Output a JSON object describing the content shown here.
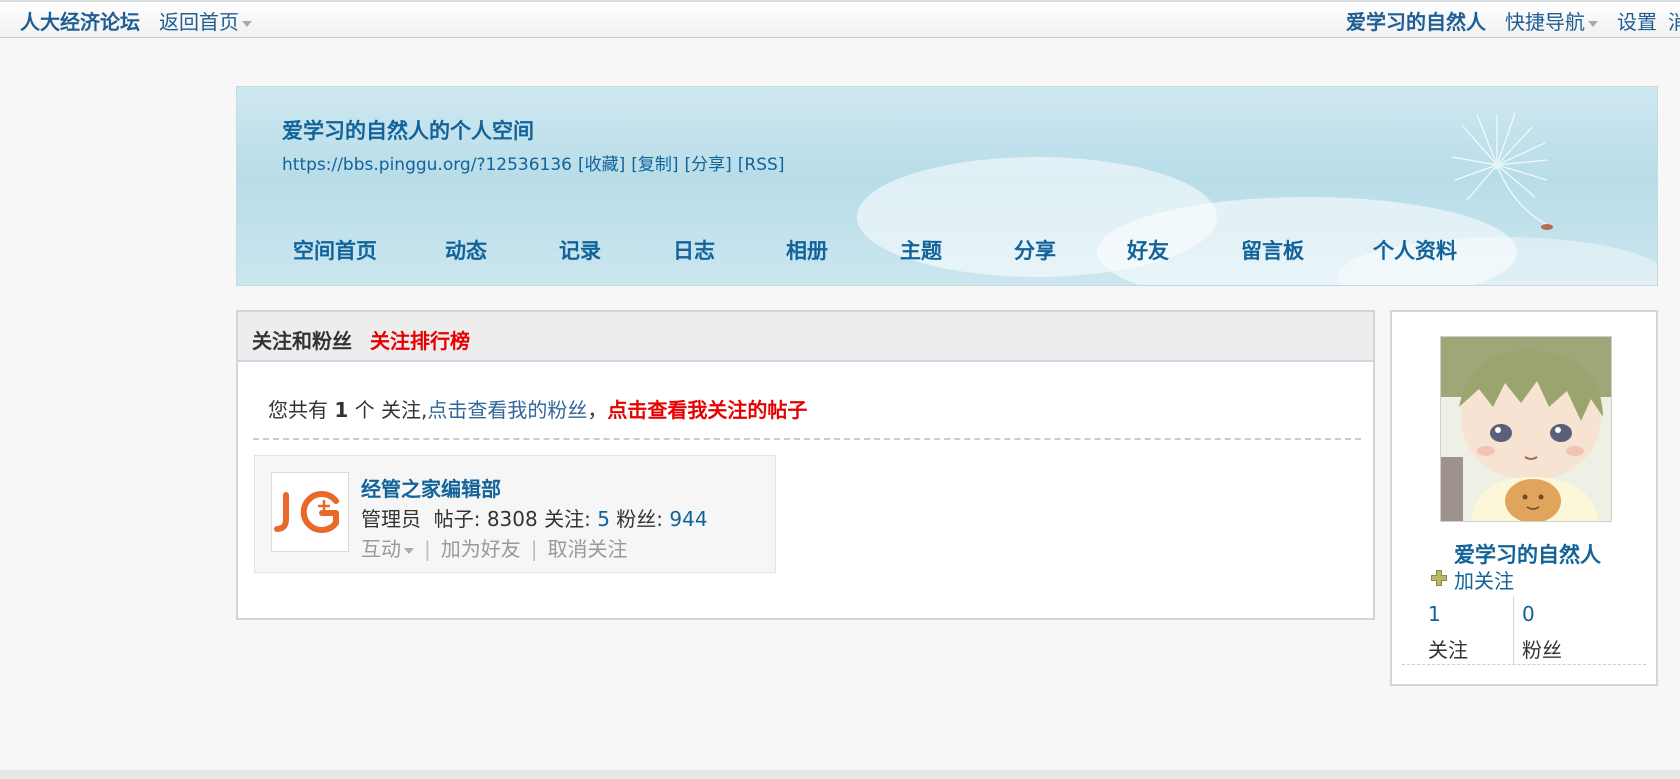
{
  "topbar": {
    "brand": "人大经济论坛",
    "home": "返回首页",
    "username": "爱学习的自然人",
    "quick_nav": "快捷导航",
    "settings": "设置",
    "cut_text": "消"
  },
  "header": {
    "space_title": "爱学习的自然人的个人空间",
    "url": "https://bbs.pinggu.org/?12536136",
    "url_actions": [
      "[收藏]",
      "[复制]",
      "[分享]",
      "[RSS]"
    ],
    "nav": [
      "空间首页",
      "动态",
      "记录",
      "日志",
      "相册",
      "主题",
      "分享",
      "好友",
      "留言板",
      "个人资料"
    ]
  },
  "main": {
    "title": "关注和粉丝",
    "rank_link": "关注排行榜",
    "summary_prefix": "您共有",
    "summary_count": "1",
    "summary_suffix": "个 关注,",
    "fans_link": "点击查看我的粉丝",
    "comma": "，",
    "posts_link": "点击查看我关注的帖子",
    "following": [
      {
        "name": "经管之家编辑部",
        "avatar_text": "JG",
        "role": "管理员",
        "posts_label": "帖子:",
        "posts": "8308",
        "follow_label": "关注:",
        "follow": "5",
        "fans_label": "粉丝:",
        "fans": "944",
        "action_interact": "互动",
        "action_add_friend": "加为好友",
        "action_unfollow": "取消关注"
      }
    ]
  },
  "side": {
    "username": "爱学习的自然人",
    "follow_button": "加关注",
    "following_count": "1",
    "following_label": "关注",
    "fans_count": "0",
    "fans_label": "粉丝"
  },
  "colors": {
    "link_blue": "#12639a",
    "accent_red": "#e60000",
    "logo_orange": "#e8692a"
  }
}
